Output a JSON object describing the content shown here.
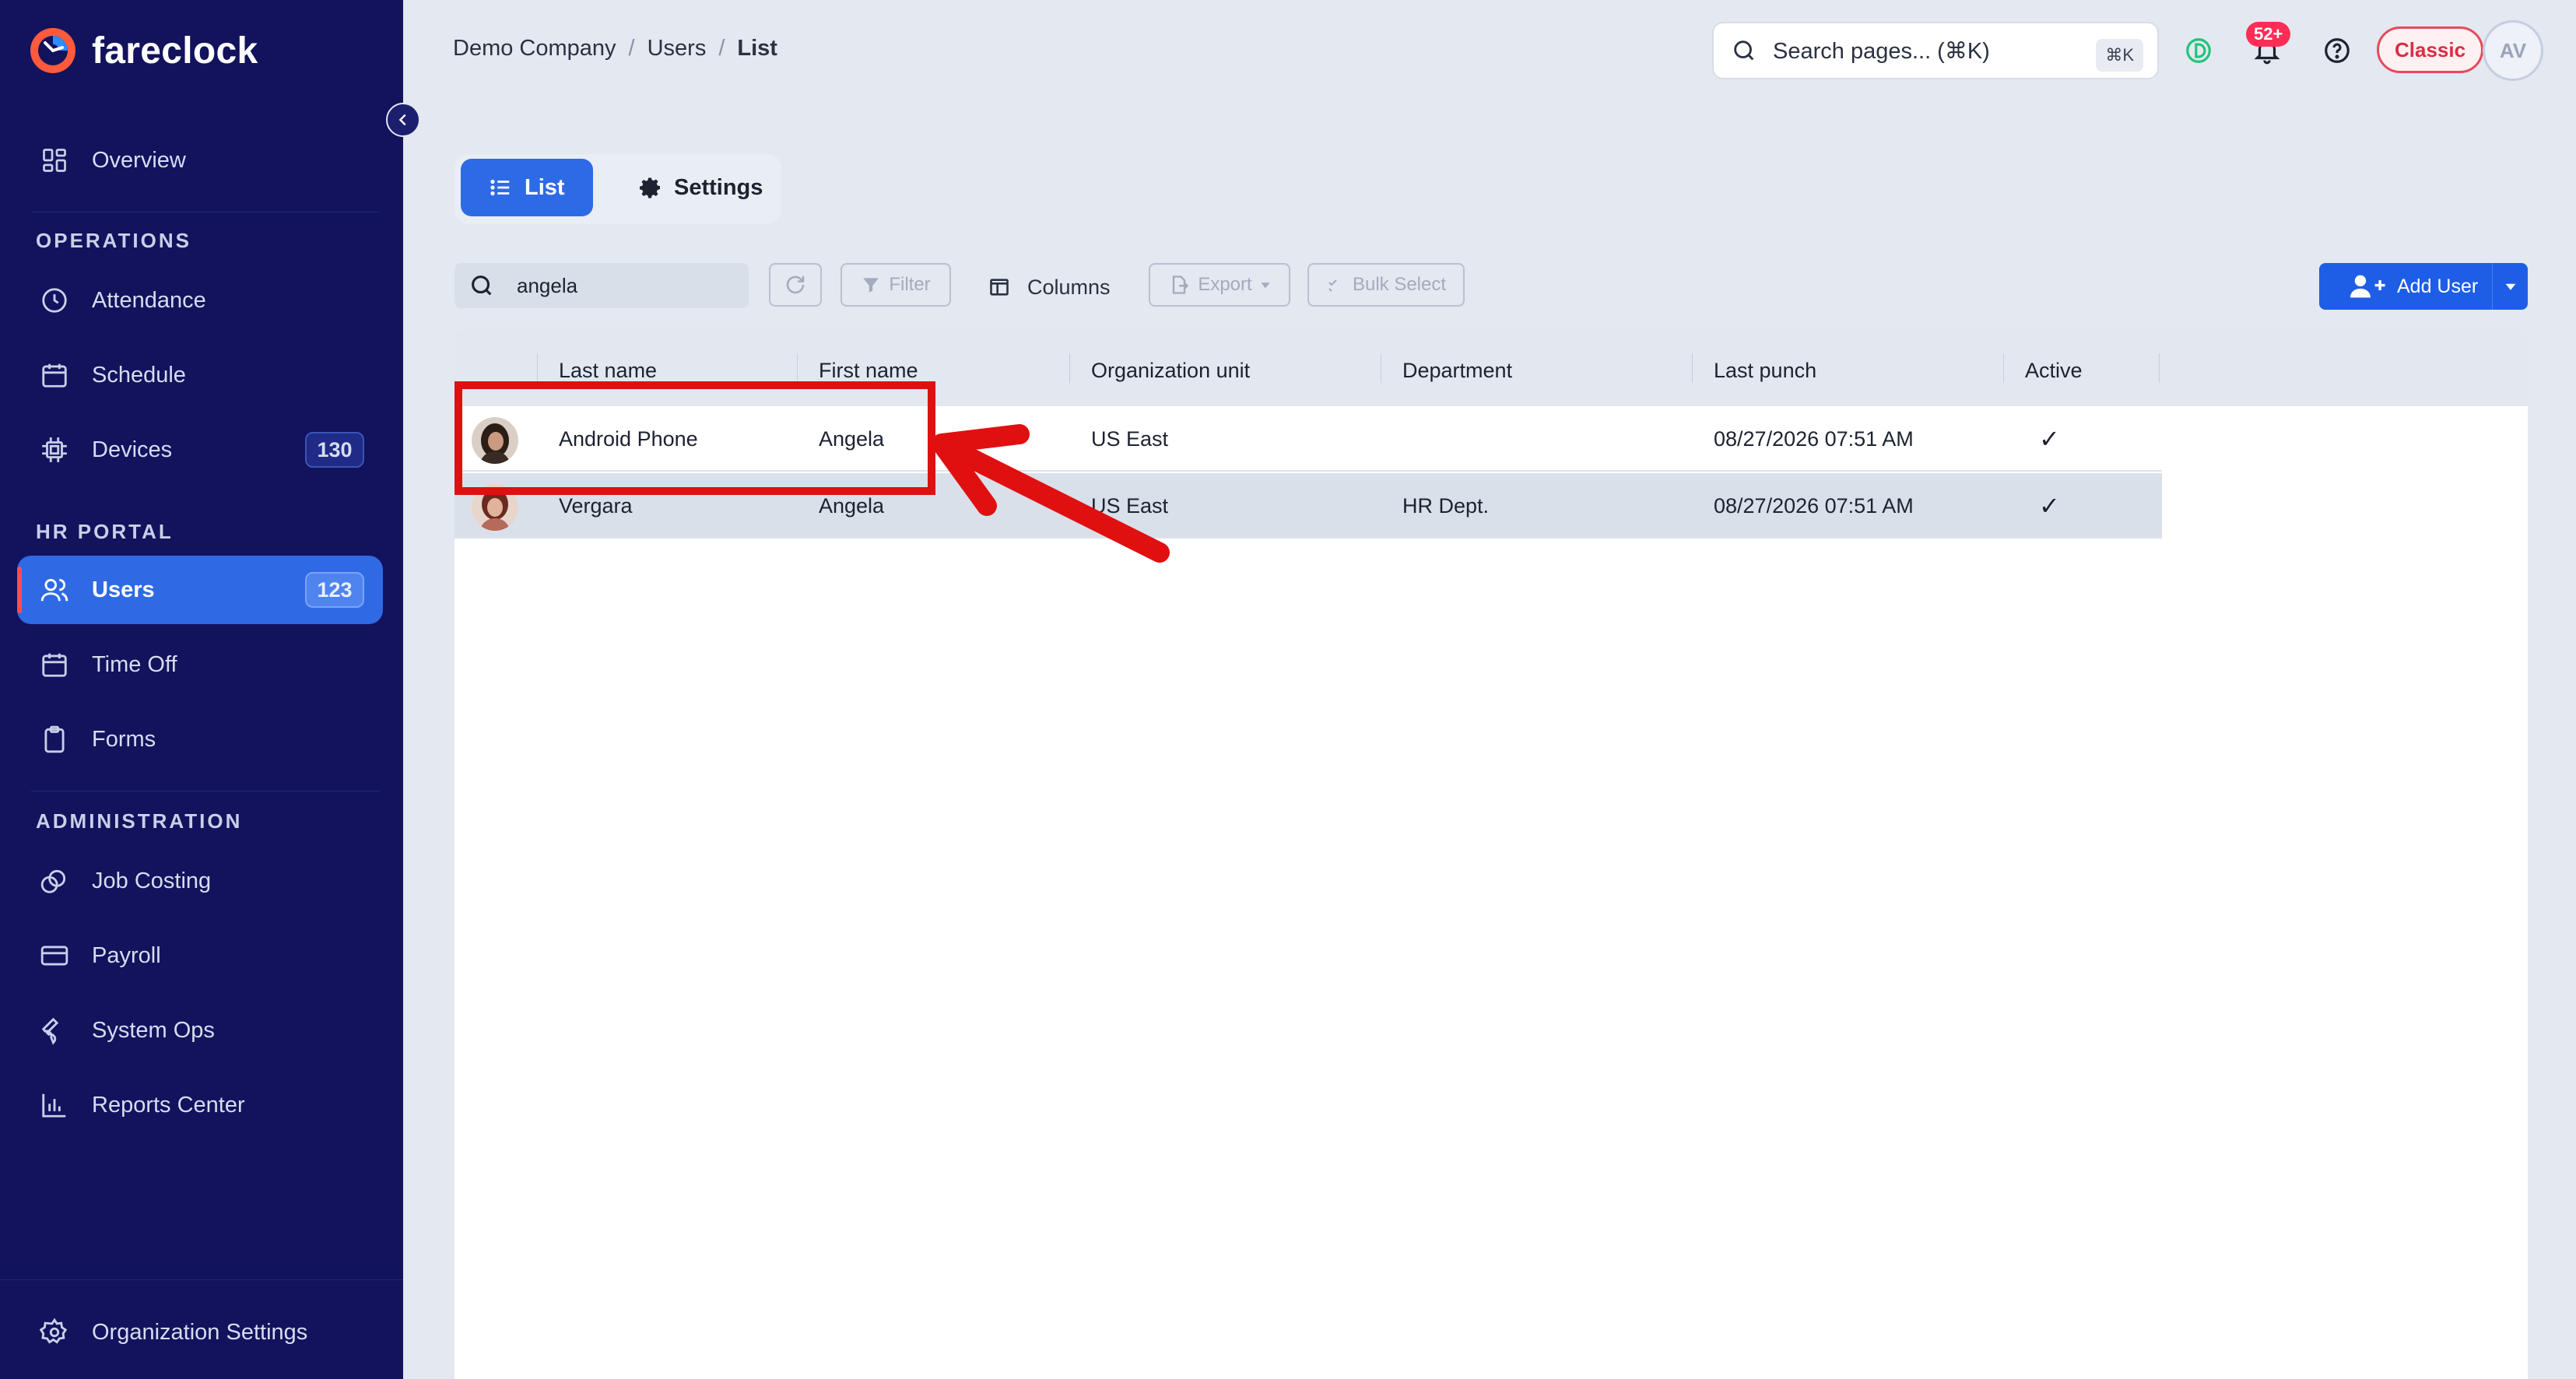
{
  "app": {
    "name": "fareclock"
  },
  "sidebar": {
    "overview": "Overview",
    "sections": {
      "operations": "OPERATIONS",
      "hr_portal": "HR PORTAL",
      "administration": "ADMINISTRATION"
    },
    "items": {
      "attendance": "Attendance",
      "schedule": "Schedule",
      "devices": "Devices",
      "devices_count": "130",
      "users": "Users",
      "users_count": "123",
      "time_off": "Time Off",
      "forms": "Forms",
      "job_costing": "Job Costing",
      "payroll": "Payroll",
      "system_ops": "System Ops",
      "reports_center": "Reports Center"
    },
    "footer": "Organization Settings"
  },
  "header": {
    "breadcrumb": [
      "Demo Company",
      "Users",
      "List"
    ],
    "breadcrumb_sep": "/",
    "search_placeholder": "Search pages... (⌘K)",
    "search_shortcut": "⌘K",
    "notifications_count": "52+",
    "classic_label": "Classic",
    "avatar_initials": "AV"
  },
  "tabs": {
    "list": "List",
    "settings": "Settings"
  },
  "toolbar": {
    "search_value": "angela",
    "filter": "Filter",
    "columns": "Columns",
    "export": "Export",
    "bulk_select": "Bulk Select",
    "add_user": "Add User"
  },
  "table": {
    "columns": {
      "last_name": "Last name",
      "first_name": "First name",
      "org_unit": "Organization unit",
      "department": "Department",
      "last_punch": "Last punch",
      "active": "Active"
    },
    "rows": [
      {
        "last_name": "Android Phone",
        "first_name": "Angela",
        "org_unit": "US East",
        "department": "",
        "last_punch": "08/27/2026 07:51 AM",
        "active": "✓"
      },
      {
        "last_name": "Vergara",
        "first_name": "Angela",
        "org_unit": "US East",
        "department": "HR Dept.",
        "last_punch": "08/27/2026 07:51 AM",
        "active": "✓"
      }
    ]
  },
  "colors": {
    "sidebar_bg": "#12125d",
    "accent": "#2d6be6",
    "annotation": "#e01010"
  }
}
